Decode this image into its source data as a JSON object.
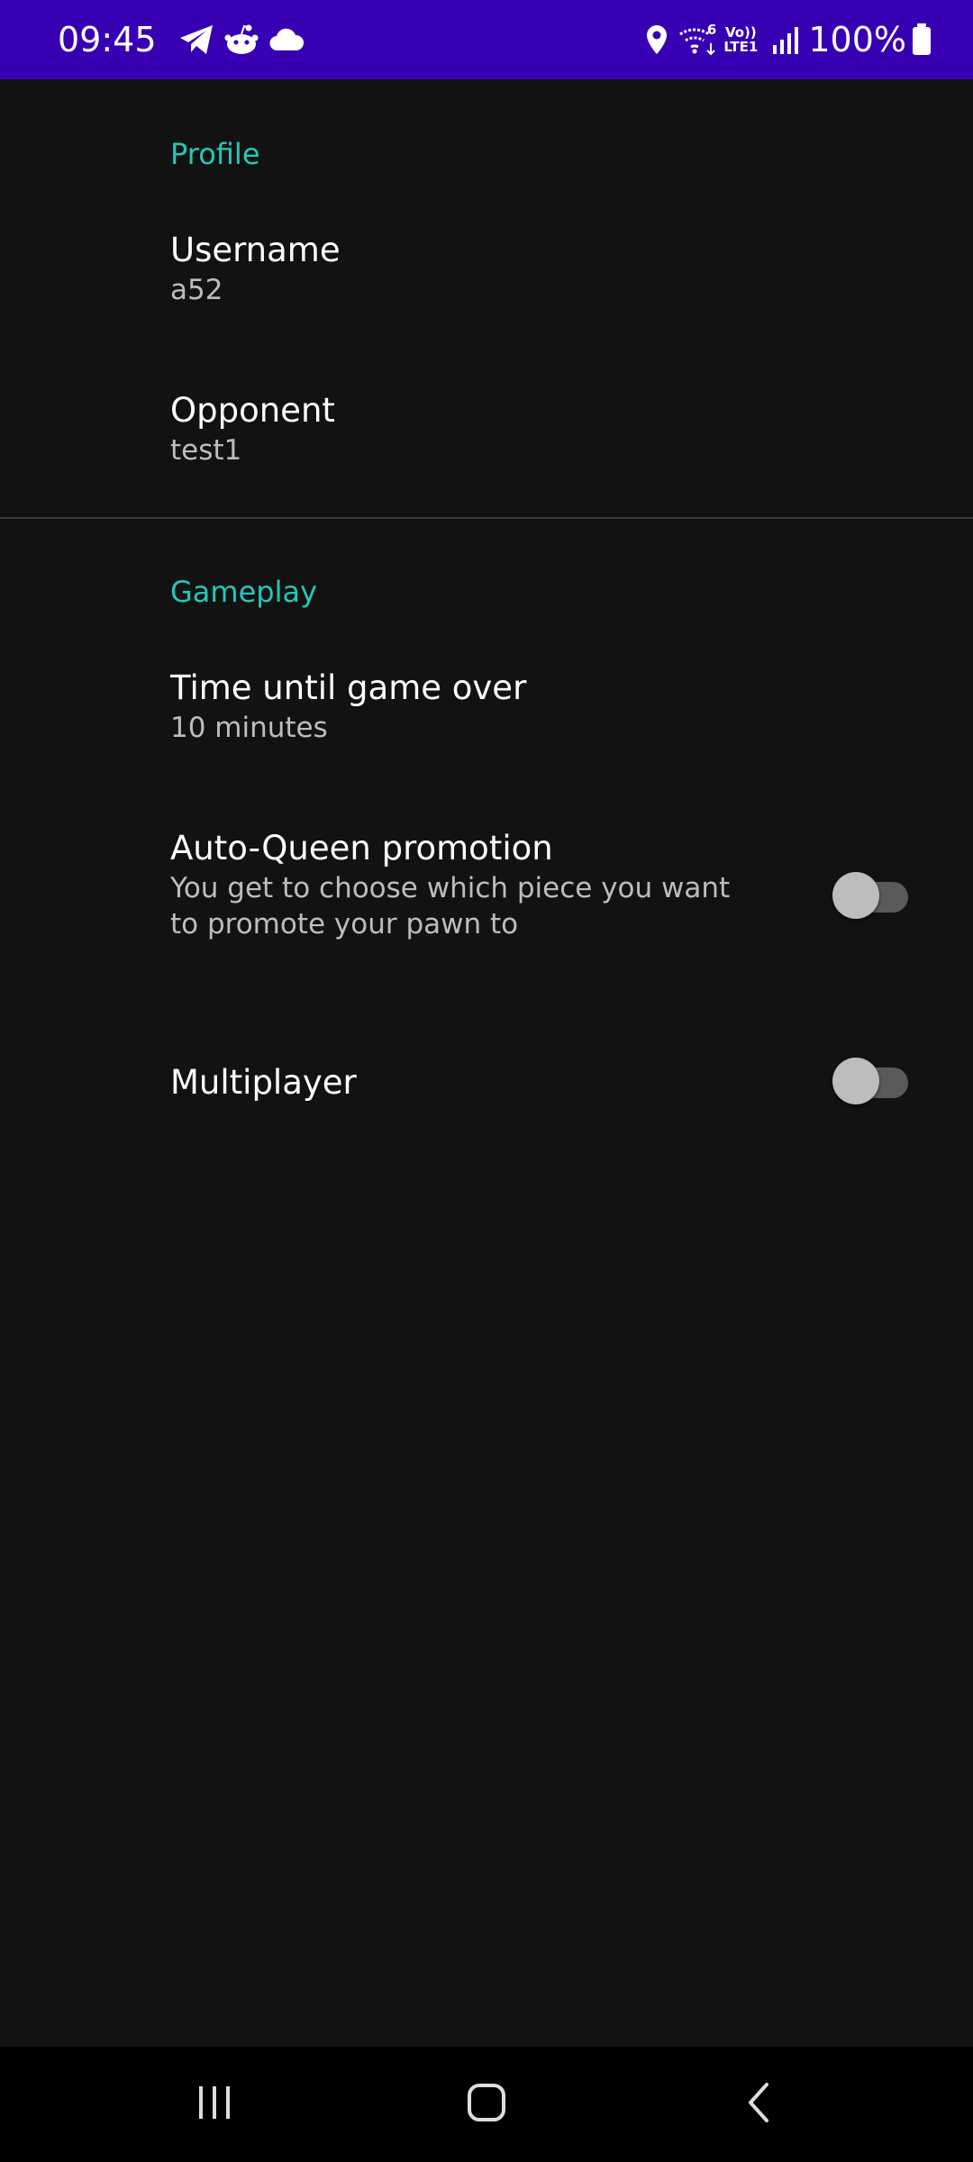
{
  "status_bar": {
    "time": "09:45",
    "left_icons": [
      "telegram-icon",
      "reddit-icon",
      "cloud-icon"
    ],
    "right_icons": [
      "location-icon",
      "wifi-icon",
      "volte-icon",
      "signal-icon",
      "battery-icon"
    ],
    "volte_top": "Vo))",
    "volte_bottom": "LTE1",
    "wifi_label": "6",
    "battery_percent": "100%",
    "bg_color": "#3700B3"
  },
  "settings": {
    "profile": {
      "category_title": "Profile",
      "username": {
        "title": "Username",
        "summary": "a52"
      },
      "opponent": {
        "title": "Opponent",
        "summary": "test1"
      }
    },
    "gameplay": {
      "category_title": "Gameplay",
      "time_until_game_over": {
        "title": "Time until game over",
        "summary": "10 minutes"
      },
      "auto_queen": {
        "title": "Auto-Queen promotion",
        "summary": "You get to choose which piece you want to promote your pawn to",
        "enabled": false
      },
      "multiplayer": {
        "title": "Multiplayer",
        "enabled": false
      }
    }
  },
  "colors": {
    "accent": "#26C6B8",
    "background": "#121212"
  },
  "nav_bar": {
    "buttons": [
      "recent-apps-icon",
      "home-icon",
      "back-icon"
    ]
  }
}
